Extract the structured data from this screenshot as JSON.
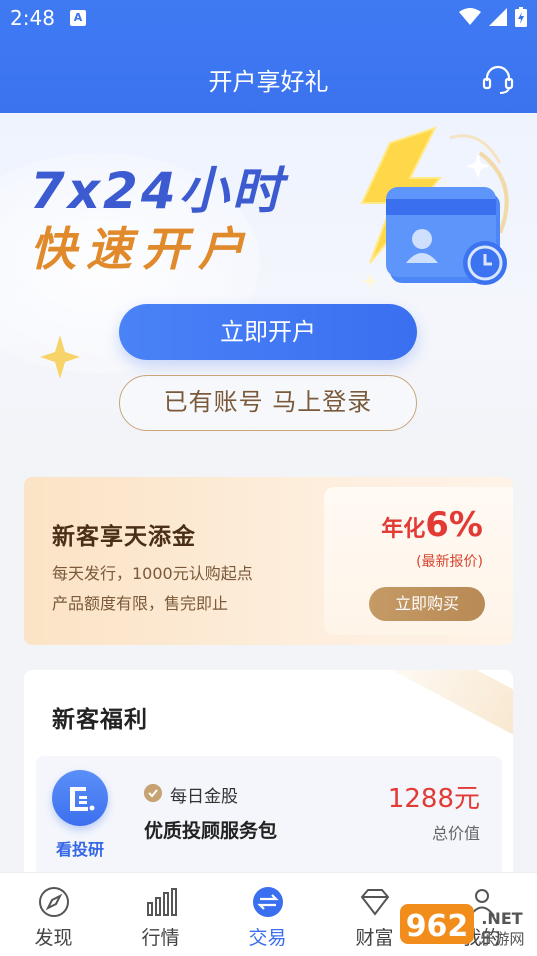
{
  "status_bar": {
    "time": "2:48",
    "a_badge": "A"
  },
  "header": {
    "title": "开户享好礼",
    "support_icon": "headset-icon"
  },
  "hero": {
    "line1": "7x24小时",
    "line2": "快速开户",
    "open_button": "立即开户",
    "login_button": "已有账号 马上登录"
  },
  "promo": {
    "title": "新客享天添金",
    "desc1": "每天发行，1000元认购起点",
    "desc2": "产品额度有限，售完即止",
    "rate_label": "年化",
    "rate_value": "6%",
    "rate_note": "(最新报价)",
    "buy_button": "立即购买"
  },
  "benefits": {
    "title": "新客福利",
    "items": [
      {
        "icon_label": "看投研",
        "tag": "每日金股",
        "name": "优质投顾服务包",
        "price": "1288元",
        "price_note": "总价值"
      }
    ]
  },
  "nav": {
    "tabs": [
      {
        "label": "发现",
        "icon": "compass-icon"
      },
      {
        "label": "行情",
        "icon": "bar-chart-icon"
      },
      {
        "label": "交易",
        "icon": "exchange-icon",
        "active": true
      },
      {
        "label": "财富",
        "icon": "diamond-icon"
      },
      {
        "label": "我的",
        "icon": "user-icon"
      }
    ]
  },
  "watermark": {
    "brand": "962",
    "suffix": ".NET",
    "sub": "乐游网"
  },
  "colors": {
    "primary": "#3a6ff0",
    "gold": "#c59a66",
    "red": "#e23a34"
  }
}
